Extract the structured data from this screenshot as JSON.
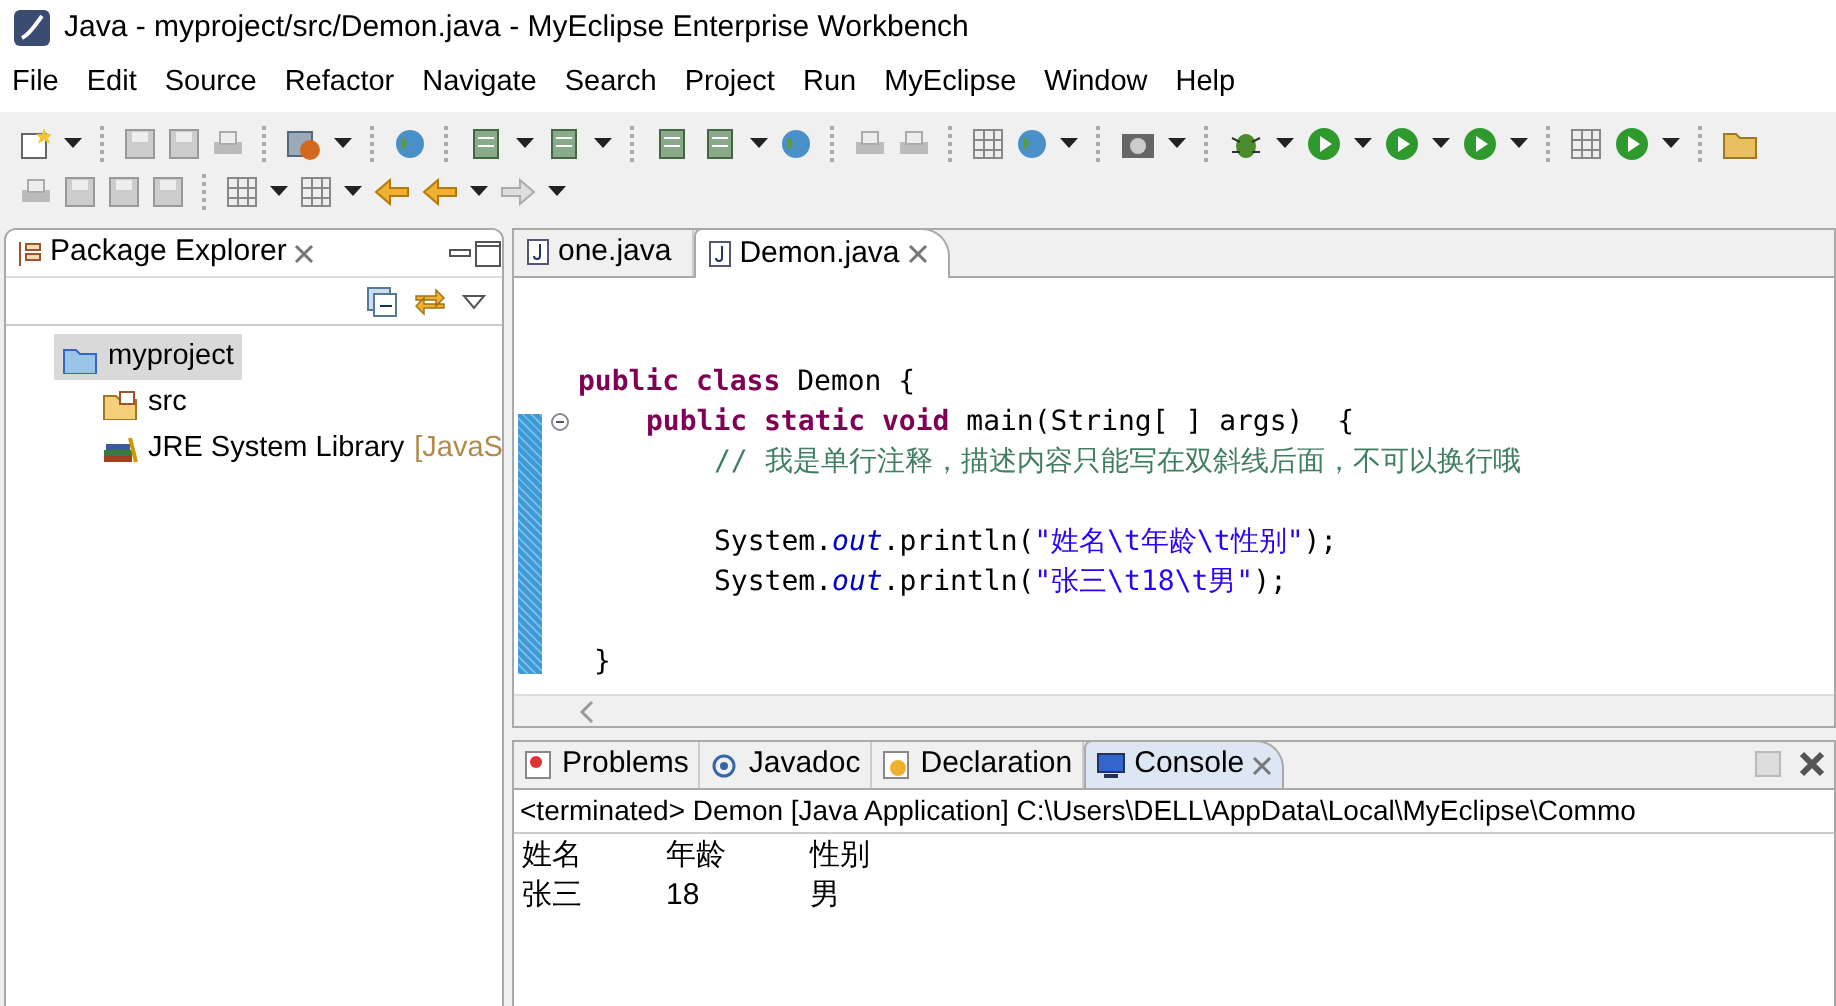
{
  "window": {
    "title": "Java - myproject/src/Demon.java - MyEclipse Enterprise Workbench"
  },
  "menu": [
    "File",
    "Edit",
    "Source",
    "Refactor",
    "Navigate",
    "Search",
    "Project",
    "Run",
    "MyEclipse",
    "Window",
    "Help"
  ],
  "package_explorer": {
    "title": "Package Explorer",
    "tree": [
      {
        "label": "myproject",
        "selected": true,
        "kind": "project",
        "children": [
          {
            "label": "src",
            "selected": false,
            "kind": "folder"
          },
          {
            "label": "JRE System Library",
            "decoration": "[JavaS",
            "selected": false,
            "kind": "library"
          }
        ]
      }
    ]
  },
  "editor": {
    "tabs": [
      {
        "label": "one.java",
        "selected": false
      },
      {
        "label": "Demon.java",
        "selected": true
      }
    ],
    "lines": [
      {
        "kind": "class",
        "gap_before": false,
        "tokens": [
          {
            "kind": "keyword",
            "text": "public class"
          },
          {
            "kind": "plain",
            "text": " Demon {"
          }
        ]
      },
      {
        "kind": "method",
        "gap_before": false,
        "folded": false,
        "tokens": [
          {
            "kind": "keyword",
            "text": "public static void"
          },
          {
            "kind": "plain",
            "text": " main(String[ ] args)  {"
          }
        ]
      },
      {
        "kind": "body",
        "gap_before": false,
        "tokens": [
          {
            "kind": "comment",
            "text": "// 我是单行注释，描述内容只能写在双斜线后面，不可以换行哦"
          }
        ]
      },
      {
        "kind": "body",
        "gap_before": true,
        "tokens": [
          {
            "kind": "plain",
            "text": "System."
          },
          {
            "kind": "field",
            "text": "out"
          },
          {
            "kind": "plain",
            "text": ".println("
          },
          {
            "kind": "string",
            "text": "\"姓名\\t年龄\\t性别\""
          },
          {
            "kind": "plain",
            "text": ");"
          }
        ]
      },
      {
        "kind": "body",
        "gap_before": false,
        "tokens": [
          {
            "kind": "plain",
            "text": "System."
          },
          {
            "kind": "field",
            "text": "out"
          },
          {
            "kind": "plain",
            "text": ".println("
          },
          {
            "kind": "string",
            "text": "\"张三\\t18\\t男\""
          },
          {
            "kind": "plain",
            "text": ");"
          }
        ]
      },
      {
        "kind": "close",
        "gap_before": true,
        "tokens": [
          {
            "kind": "plain",
            "text": "}"
          }
        ]
      }
    ]
  },
  "console": {
    "tabs": [
      {
        "label": "Problems",
        "selected": false,
        "kind": "problems"
      },
      {
        "label": "Javadoc",
        "selected": false,
        "kind": "javadoc"
      },
      {
        "label": "Declaration",
        "selected": false,
        "kind": "declaration"
      },
      {
        "label": "Console",
        "selected": true,
        "kind": "console"
      }
    ],
    "header": "<terminated> Demon [Java Application] C:\\Users\\DELL\\AppData\\Local\\MyEclipse\\Commo",
    "output": [
      [
        "姓名",
        "年龄",
        "性别"
      ],
      [
        "张三",
        "18",
        "男"
      ]
    ]
  }
}
